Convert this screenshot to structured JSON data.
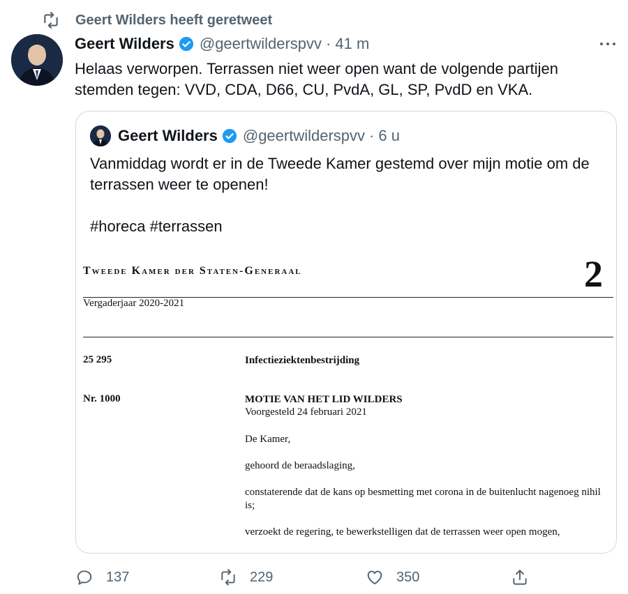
{
  "retweet_banner": {
    "text": "Geert Wilders heeft geretweet"
  },
  "tweet": {
    "name": "Geert Wilders",
    "handle": "@geertwilderspvv",
    "separator": "·",
    "time": "41 m",
    "text": "Helaas verworpen. Terrassen niet weer open want de volgende partijen stemden tegen: VVD, CDA, D66, CU, PvdA, GL, SP, PvdD en VKA."
  },
  "quoted": {
    "name": "Geert Wilders",
    "handle": "@geertwilderspvv",
    "separator": "·",
    "time": "6 u",
    "text": "Vanmiddag wordt er in de Tweede Kamer gestemd over mijn motie om de terrassen weer te openen!",
    "hashtags": "#horeca #terrassen",
    "document": {
      "title": "Tweede Kamer der Staten-Generaal",
      "number": "2",
      "year": "Vergaderjaar 2020-2021",
      "dossier_no": "25 295",
      "dossier_title": "Infectieziektenbestrijding",
      "motion_no": "Nr. 1000",
      "motion_title": "MOTIE VAN HET LID WILDERS",
      "proposed": "Voorgesteld 24 februari 2021",
      "line1": "De Kamer,",
      "line2": "gehoord de beraadslaging,",
      "line3": "constaterende dat de kans op besmetting met corona in de buitenlucht nagenoeg nihil is;",
      "line4": "verzoekt de regering, te bewerkstelligen dat de terrassen weer open mogen,"
    }
  },
  "actions": {
    "reply_count": "137",
    "retweet_count": "229",
    "like_count": "350"
  },
  "colors": {
    "verified": "#1d9bf0",
    "muted": "#536471",
    "border": "#cfd9de"
  },
  "icons": [
    "retweet-icon",
    "verified-badge-icon",
    "more-icon",
    "reply-icon",
    "like-icon",
    "share-icon"
  ]
}
